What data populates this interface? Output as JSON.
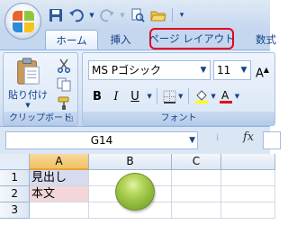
{
  "tabs": [
    {
      "label": "ホーム",
      "active": true
    },
    {
      "label": "挿入",
      "active": false
    },
    {
      "label": "ページ レイアウト",
      "active": false,
      "highlighted": true
    },
    {
      "label": "数式",
      "active": false
    }
  ],
  "ribbon": {
    "clipboard": {
      "group_label": "クリップボード",
      "paste_label": "貼り付け"
    },
    "font": {
      "group_label": "フォント",
      "font_name": "MS Pゴシック",
      "font_size": "11",
      "bold_label": "B",
      "italic_label": "I",
      "underline_label": "U",
      "font_color": "#e8001d",
      "highlight_color": "#ffff00"
    }
  },
  "formula_bar": {
    "name_box": "G14",
    "fx_label": "fx"
  },
  "grid": {
    "columns": [
      "A",
      "B",
      "C"
    ],
    "selected_column": "A",
    "rows": [
      {
        "num": "1",
        "A": "見出し",
        "A_fill": "#d7dbef"
      },
      {
        "num": "2",
        "A": "本文",
        "A_fill": "#f2d6d8"
      },
      {
        "num": "3",
        "A": "",
        "A_fill": ""
      }
    ],
    "shape_color": "#8db83a"
  }
}
